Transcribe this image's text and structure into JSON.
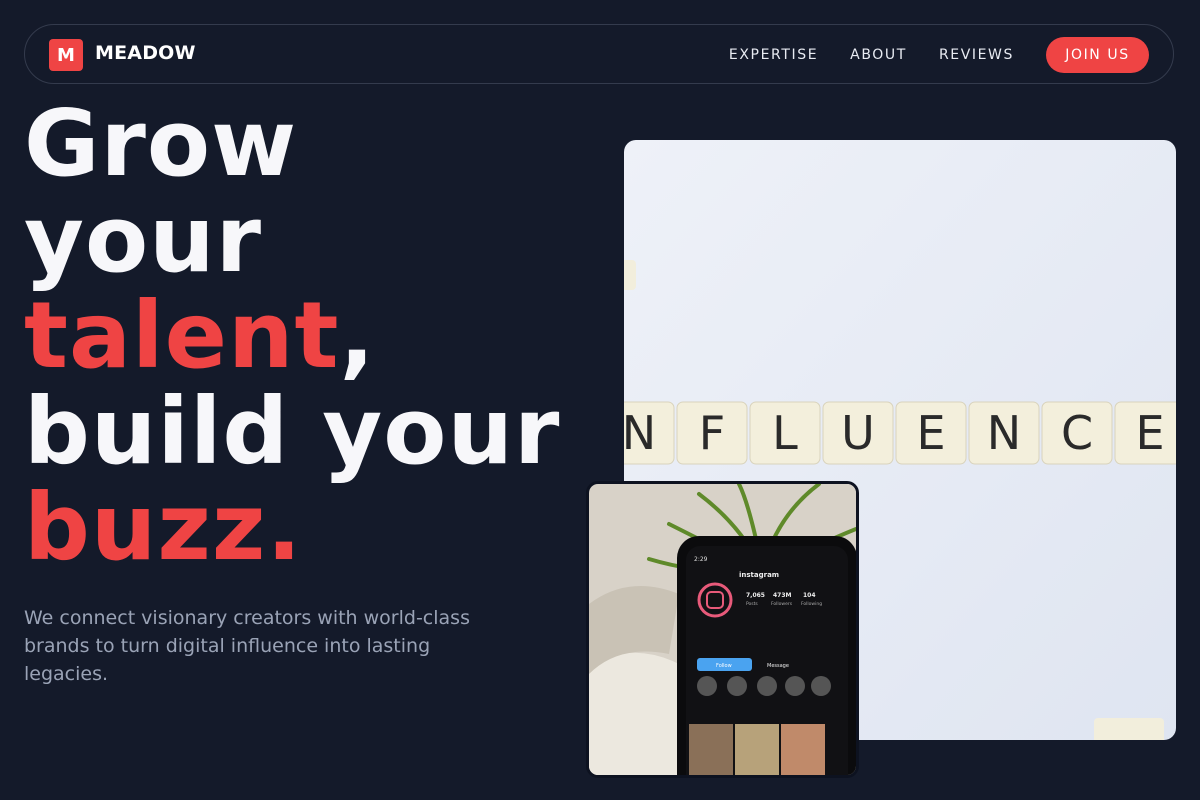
{
  "brand": {
    "logo_letter": "M",
    "name": "MEADOW",
    "accent_color": "#ef4444"
  },
  "nav": {
    "links": [
      "EXPERTISE",
      "ABOUT",
      "REVIEWS"
    ],
    "cta": "JOIN US"
  },
  "hero": {
    "line1": "Grow",
    "line2": "your",
    "line3_accent": "talent",
    "line3_rest": ",",
    "line4": "build your",
    "line5_accent": "buzz.",
    "subtitle": "We connect visionary creators with world-class brands to turn digital influence into lasting legacies."
  },
  "images": {
    "main": {
      "tiles": [
        "N",
        "F",
        "L",
        "U",
        "E",
        "N",
        "C",
        "E"
      ]
    },
    "phone": {
      "username": "instagram",
      "time": "2:29",
      "stats": [
        {
          "value": "7,065",
          "label": "Posts"
        },
        {
          "value": "473M",
          "label": "Followers"
        },
        {
          "value": "104",
          "label": "Following"
        }
      ],
      "follow_label": "Follow",
      "message_label": "Message"
    }
  }
}
